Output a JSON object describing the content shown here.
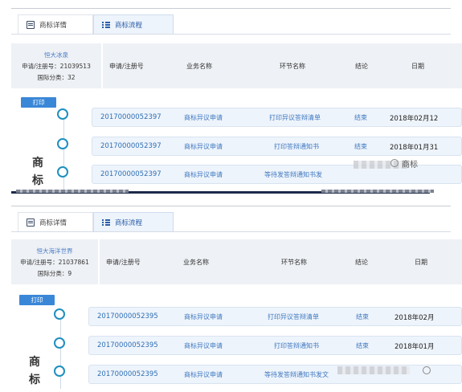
{
  "tabs": {
    "detail": "商标详情",
    "flow": "商标流程"
  },
  "columns": {
    "num": "申请/注册号",
    "biz": "业务名称",
    "step": "环节名称",
    "result": "结论",
    "date": "日期"
  },
  "print_label": "打印",
  "watermark": "商标",
  "panel1": {
    "name": "恒大冰泉",
    "reg_line": "申请/注册号：21039513",
    "class_line": "国际分类：32",
    "rows": [
      {
        "num": "20170000052397",
        "biz": "商标异议申请",
        "step": "打印异议答辩清单",
        "result": "结束",
        "date": "2018年02月12"
      },
      {
        "num": "20170000052397",
        "biz": "商标异议申请",
        "step": "打印答辩通知书",
        "result": "结束",
        "date": "2018年01月31"
      },
      {
        "num": "20170000052397",
        "biz": "商标异议申请",
        "step": "等待发答辩通知书发",
        "result": "",
        "date": ""
      }
    ],
    "side_chars": [
      "商",
      "标"
    ]
  },
  "panel2": {
    "name": "恒大海洋世界",
    "reg_line": "申请/注册号：21037861",
    "class_line": "国际分类：9",
    "rows": [
      {
        "num": "20170000052395",
        "biz": "商标异议申请",
        "step": "打印异议答辩清单",
        "result": "结束",
        "date": "2018年02月"
      },
      {
        "num": "20170000052395",
        "biz": "商标异议申请",
        "step": "打印答辩通知书",
        "result": "结束",
        "date": "2018年01月"
      },
      {
        "num": "20170000052395",
        "biz": "商标异议申请",
        "step": "等待发答辩通知书发文",
        "result": "",
        "date": ""
      }
    ],
    "side_chars": [
      "商",
      "标"
    ]
  }
}
